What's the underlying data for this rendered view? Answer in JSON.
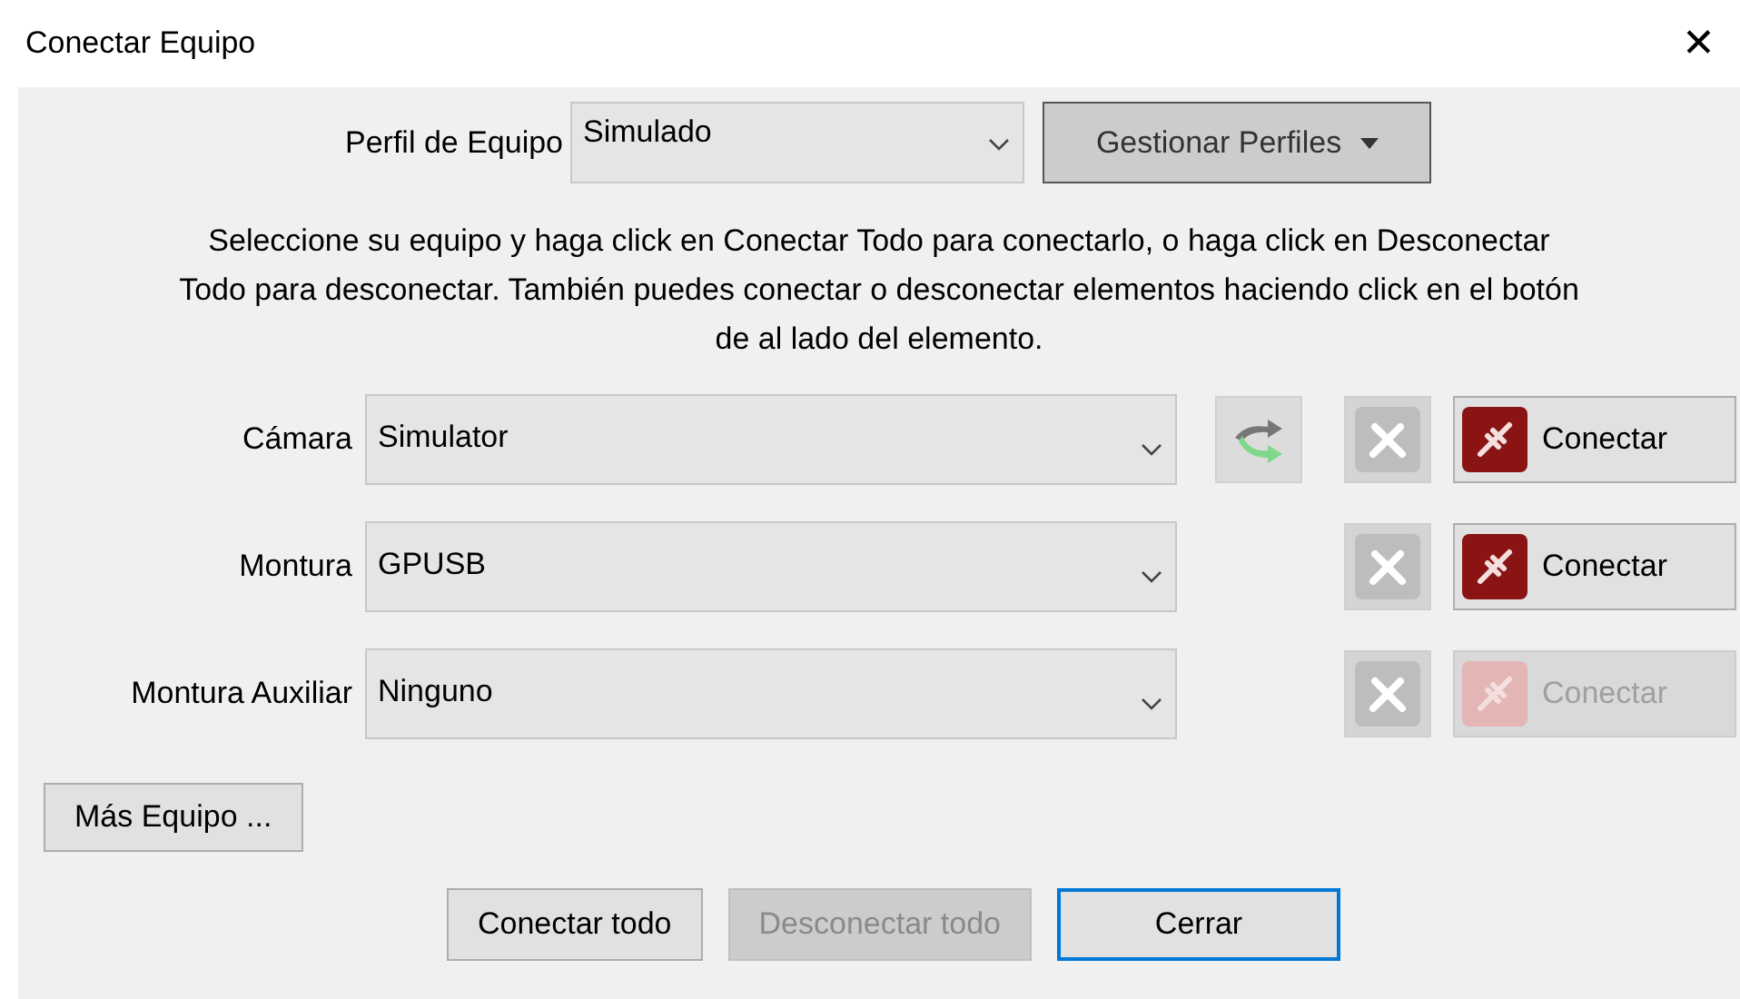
{
  "window": {
    "title": "Conectar Equipo",
    "close": "✕"
  },
  "profile": {
    "label": "Perfil de Equipo",
    "value": "Simulado",
    "manage_button": "Gestionar Perfiles"
  },
  "instructions": "Seleccione su equipo y haga click en Conectar Todo para conectarlo, o haga click en Desconectar Todo para desconectar. También puedes conectar o desconectar elementos haciendo click en el botón de al lado del elemento.",
  "devices": [
    {
      "label": "Cámara",
      "value": "Simulator",
      "swap_button": true,
      "connect": "Conectar",
      "disabled": false
    },
    {
      "label": "Montura",
      "value": "GPUSB",
      "swap_button": false,
      "connect": "Conectar",
      "disabled": false
    },
    {
      "label": "Montura Auxiliar",
      "value": "Ninguno",
      "swap_button": false,
      "connect": "Conectar",
      "disabled": true
    }
  ],
  "more_button": "Más Equipo ...",
  "buttons": [
    {
      "label": "Conectar todo",
      "disabled": false,
      "focused": false
    },
    {
      "label": "Desconectar todo",
      "disabled": true,
      "focused": false
    },
    {
      "label": "Cerrar",
      "disabled": false,
      "focused": true
    }
  ]
}
